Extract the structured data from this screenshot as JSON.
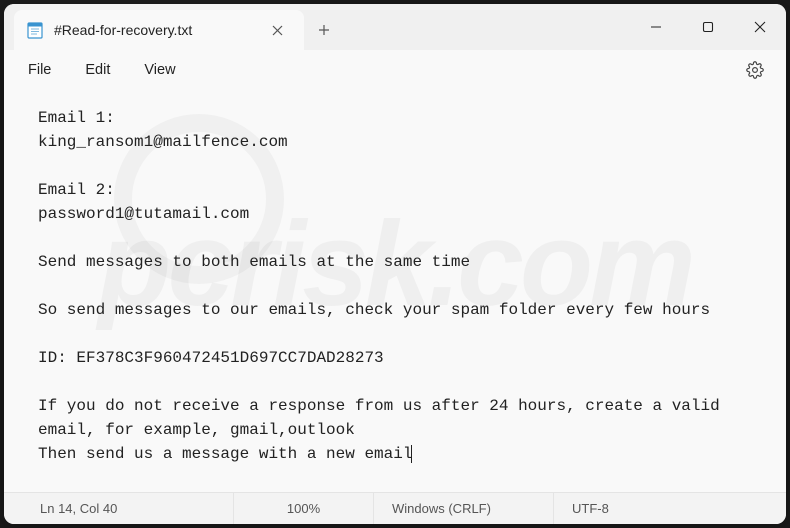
{
  "tab": {
    "title": "#Read-for-recovery.txt"
  },
  "menu": {
    "file": "File",
    "edit": "Edit",
    "view": "View"
  },
  "content": "Email 1:\nking_ransom1@mailfence.com\n\nEmail 2:\npassword1@tutamail.com\n\nSend messages to both emails at the same time\n\nSo send messages to our emails, check your spam folder every few hours\n\nID: EF378C3F960472451D697CC7DAD28273\n\nIf you do not receive a response from us after 24 hours, create a valid\nemail, for example, gmail,outlook\nThen send us a message with a new email",
  "status": {
    "position": "Ln 14, Col 40",
    "zoom": "100%",
    "eol": "Windows (CRLF)",
    "encoding": "UTF-8"
  }
}
